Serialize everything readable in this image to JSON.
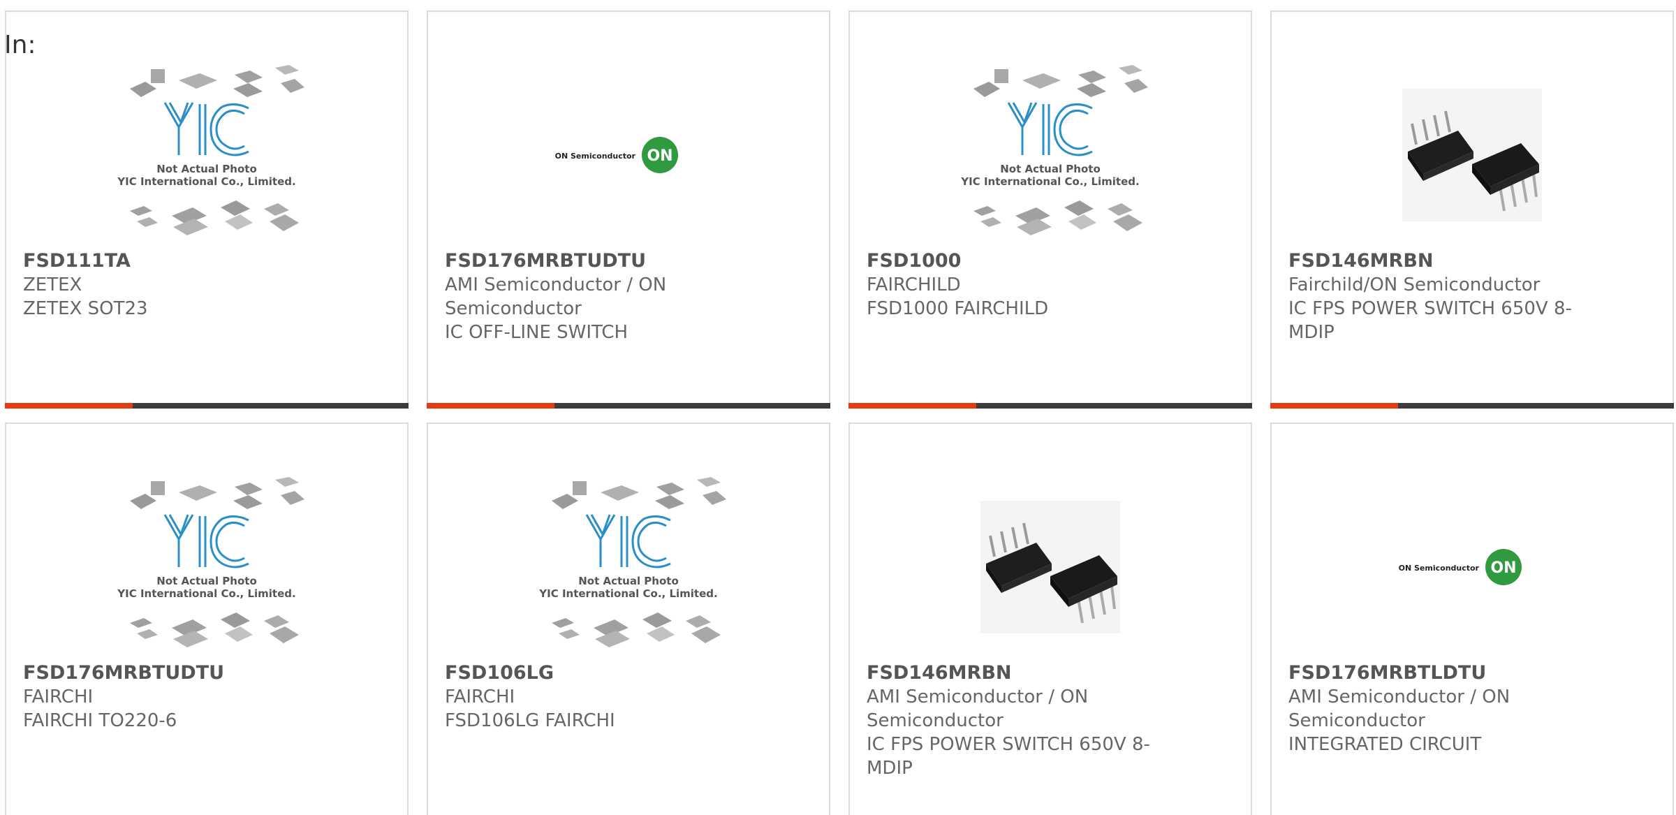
{
  "filter_label": "In:",
  "colors": {
    "accent": "#e63b12",
    "bar_dark": "#3b3b3b",
    "border": "#dcdcdc",
    "text": "#666666",
    "yic_blue": "#2a8fc7",
    "on_green": "#2f9a3f"
  },
  "cards": [
    {
      "pn": "FSD111TA",
      "mfr": "ZETEX",
      "desc": "ZETEX SOT23",
      "image": "yic-placeholder"
    },
    {
      "pn": "FSD176MRBTUDTU",
      "mfr": "AMI Semiconductor / ON Semiconductor",
      "desc": "IC OFF-LINE SWITCH",
      "image": "on-semiconductor-logo"
    },
    {
      "pn": "FSD1000",
      "mfr": "FAIRCHILD",
      "desc": "FSD1000 FAIRCHILD",
      "image": "yic-placeholder"
    },
    {
      "pn": "FSD146MRBN",
      "mfr": "Fairchild/ON Semiconductor",
      "desc": "IC FPS POWER SWITCH 650V 8-MDIP",
      "image": "dip-chip"
    },
    {
      "pn": "FSD176MRBTUDTU",
      "mfr": "FAIRCHI",
      "desc": "FAIRCHI TO220-6",
      "image": "yic-placeholder"
    },
    {
      "pn": "FSD106LG",
      "mfr": "FAIRCHI",
      "desc": "FSD106LG FAIRCHI",
      "image": "yic-placeholder"
    },
    {
      "pn": "FSD146MRBN",
      "mfr": "AMI Semiconductor / ON Semiconductor",
      "desc": "IC FPS POWER SWITCH 650V 8-MDIP",
      "image": "dip-chip"
    },
    {
      "pn": "FSD176MRBTLDTU",
      "mfr": "AMI Semiconductor / ON Semiconductor",
      "desc": "INTEGRATED CIRCUIT",
      "image": "on-semiconductor-logo"
    }
  ],
  "yic_placeholder": {
    "line1": "Not Actual Photo",
    "line2": "YIC International Co., Limited."
  },
  "on_logo": {
    "wordmark": "ON Semiconductor",
    "badge": "ON"
  }
}
